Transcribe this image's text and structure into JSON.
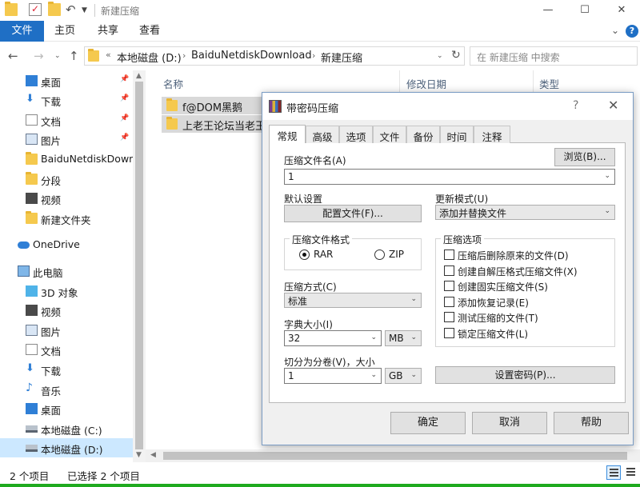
{
  "explorer": {
    "window_title": "新建压缩",
    "ribbon": {
      "file": "文件",
      "home": "主页",
      "share": "共享",
      "view": "查看"
    },
    "address": {
      "crumbs": [
        "本地磁盘 (D:)",
        "BaiduNetdiskDownload",
        "新建压缩"
      ],
      "overflow": "«",
      "search_placeholder": "在 新建压缩 中搜索"
    },
    "nav": [
      {
        "label": "桌面",
        "pinned": true,
        "icon": "desktop-icon"
      },
      {
        "label": "下载",
        "pinned": true,
        "icon": "download-icon"
      },
      {
        "label": "文档",
        "pinned": true,
        "icon": "document-icon"
      },
      {
        "label": "图片",
        "pinned": true,
        "icon": "picture-icon"
      },
      {
        "label": "BaiduNetdiskDown",
        "pinned": false,
        "icon": "folder-icon"
      },
      {
        "label": "分段",
        "pinned": false,
        "icon": "folder-icon"
      },
      {
        "label": "视频",
        "pinned": false,
        "icon": "video-icon"
      },
      {
        "label": "新建文件夹",
        "pinned": false,
        "icon": "folder-icon"
      },
      {
        "label": "OneDrive",
        "pinned": false,
        "icon": "cloud-icon"
      },
      {
        "label": "此电脑",
        "pinned": false,
        "icon": "computer-icon"
      },
      {
        "label": "3D 对象",
        "pinned": false,
        "icon": "3d-objects-icon"
      },
      {
        "label": "视频",
        "pinned": false,
        "icon": "video-icon"
      },
      {
        "label": "图片",
        "pinned": false,
        "icon": "picture-icon"
      },
      {
        "label": "文档",
        "pinned": false,
        "icon": "document-icon"
      },
      {
        "label": "下载",
        "pinned": false,
        "icon": "download-icon"
      },
      {
        "label": "音乐",
        "pinned": false,
        "icon": "music-icon"
      },
      {
        "label": "桌面",
        "pinned": false,
        "icon": "desktop-icon"
      },
      {
        "label": "本地磁盘 (C:)",
        "pinned": false,
        "icon": "drive-icon"
      },
      {
        "label": "本地磁盘 (D:)",
        "pinned": false,
        "icon": "drive-icon",
        "selected": true
      }
    ],
    "columns": {
      "name": "名称",
      "date": "修改日期",
      "type": "类型"
    },
    "files": [
      {
        "name": "f@DOM黑鹅"
      },
      {
        "name": "上老王论坛当老王"
      }
    ],
    "status": {
      "count": "2 个项目",
      "selected": "已选择 2 个项目"
    }
  },
  "dialog": {
    "title": "带密码压缩",
    "help": "?",
    "tabs": [
      "常规",
      "高级",
      "选项",
      "文件",
      "备份",
      "时间",
      "注释"
    ],
    "active_tab": 0,
    "archive_name_label": "压缩文件名(A)",
    "browse_label": "浏览(B)...",
    "archive_name_value": "1",
    "default_settings_label": "默认设置",
    "profiles_label": "配置文件(F)...",
    "update_mode_label": "更新模式(U)",
    "update_mode_value": "添加并替换文件",
    "format_group": "压缩文件格式",
    "format_rar": "RAR",
    "format_zip": "ZIP",
    "selected_format": "RAR",
    "method_label": "压缩方式(C)",
    "method_value": "标准",
    "dict_label": "字典大小(I)",
    "dict_value": "32",
    "dict_unit": "MB",
    "split_label": "切分为分卷(V)，大小",
    "split_value": "1",
    "split_unit": "GB",
    "options_group": "压缩选项",
    "options": [
      {
        "label": "压缩后删除原来的文件(D)",
        "checked": false
      },
      {
        "label": "创建自解压格式压缩文件(X)",
        "checked": false
      },
      {
        "label": "创建固实压缩文件(S)",
        "checked": false
      },
      {
        "label": "添加恢复记录(E)",
        "checked": false
      },
      {
        "label": "测试压缩的文件(T)",
        "checked": false
      },
      {
        "label": "锁定压缩文件(L)",
        "checked": false
      }
    ],
    "set_password_label": "设置密码(P)...",
    "ok_label": "确定",
    "cancel_label": "取消",
    "help_label": "帮助"
  }
}
